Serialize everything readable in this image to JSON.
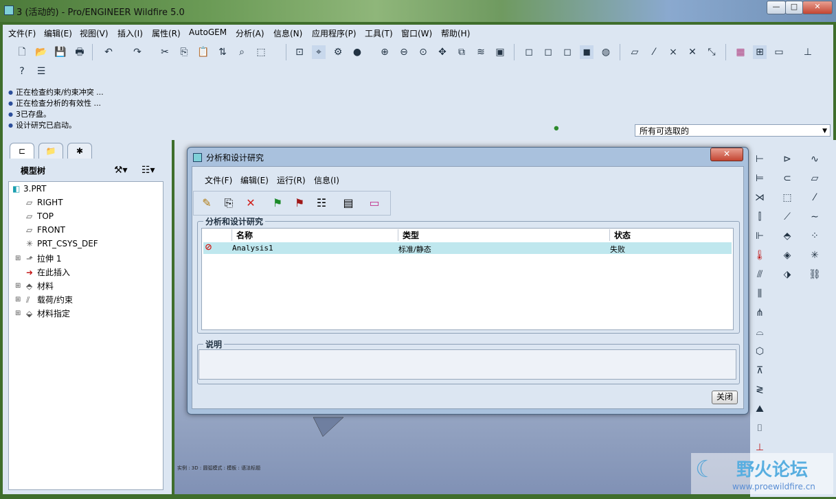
{
  "window": {
    "title": "3 (活动的) - Pro/ENGINEER Wildfire 5.0",
    "min": "—",
    "max": "□",
    "close": "✕"
  },
  "menu": [
    "文件(F)",
    "编辑(E)",
    "视图(V)",
    "插入(I)",
    "属性(R)",
    "AutoGEM",
    "分析(A)",
    "信息(N)",
    "应用程序(P)",
    "工具(T)",
    "窗口(W)",
    "帮助(H)"
  ],
  "messages": [
    "正在检查约束/约束冲突 ...",
    "正在检查分析的有效性 ...",
    "3已存盘。",
    "设计研究已启动。"
  ],
  "filter": {
    "selected": "所有可选取的"
  },
  "panel": {
    "title": "模型树"
  },
  "tree": [
    {
      "label": "3.PRT",
      "icon": "part-icon"
    },
    {
      "label": "RIGHT",
      "icon": "datum-plane-icon"
    },
    {
      "label": "TOP",
      "icon": "datum-plane-icon"
    },
    {
      "label": "FRONT",
      "icon": "datum-plane-icon"
    },
    {
      "label": "PRT_CSYS_DEF",
      "icon": "csys-icon"
    },
    {
      "label": "拉伸 1",
      "icon": "extrude-icon"
    },
    {
      "label": "在此插入",
      "icon": "insert-here-icon"
    },
    {
      "label": "材料",
      "icon": "material-icon"
    },
    {
      "label": "载荷/约束",
      "icon": "loads-icon"
    },
    {
      "label": "材料指定",
      "icon": "material-assign-icon"
    }
  ],
  "dialog": {
    "title": "分析和设计研究",
    "menu": [
      "文件(F)",
      "编辑(E)",
      "运行(R)",
      "信息(I)"
    ],
    "group_label": "分析和设计研究",
    "columns": [
      "名称",
      "类型",
      "状态"
    ],
    "rows": [
      {
        "name": "Analysis1",
        "type": "标准/静态",
        "status": "失败"
      }
    ],
    "desc_label": "说明",
    "close_label": "关闭"
  },
  "status_bar": "实例 : 3D : 圆弧模式 : 模板 : 语法标题",
  "watermark": {
    "title": "野火论坛",
    "url": "www.proewildfire.cn"
  },
  "colors": {
    "accent": "#2b4e9a",
    "selected_row": "#bfe7ee",
    "error": "#d0201b"
  }
}
